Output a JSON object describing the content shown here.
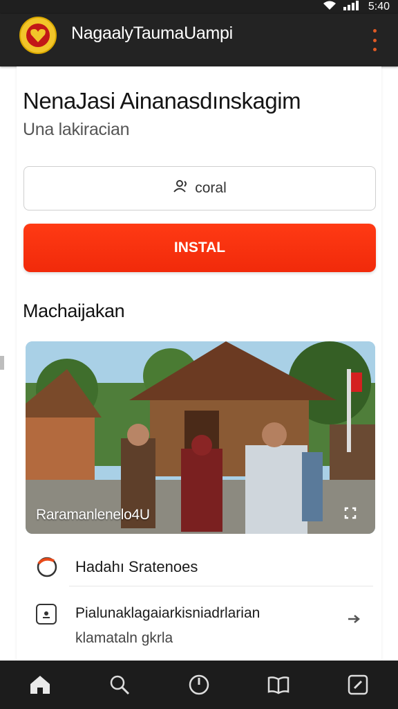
{
  "status": {
    "time": "5:40"
  },
  "app": {
    "title": "NagaalyTaumaUampi"
  },
  "hero": {
    "title": "NenaJasi Ainanasdınskagim",
    "subtitle": "Una lakiracian"
  },
  "buttons": {
    "secondary_label": "coral",
    "primary_label": "INSTAL"
  },
  "section": {
    "title": "Machaijakan"
  },
  "photo": {
    "caption": "Raramanlenelo4U"
  },
  "list": [
    {
      "label": "Hadahı Sratenoes"
    },
    {
      "label": "Pialunaklagaiarkisniadrlarian",
      "sub": "klamataln gkrla"
    }
  ],
  "colors": {
    "primary": "#f12a0a",
    "appbar": "#232323",
    "nav": "#1c1c1c"
  },
  "icons": {
    "nav": [
      "home-icon",
      "search-icon",
      "power-icon",
      "book-icon",
      "edit-icon"
    ]
  }
}
